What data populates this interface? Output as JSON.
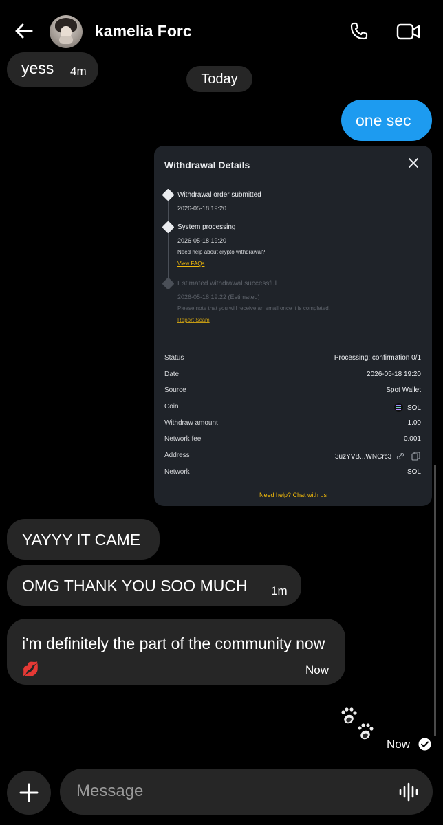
{
  "header": {
    "contact_name": "kamelia Forc",
    "icons": [
      "back-arrow-icon",
      "phone-icon",
      "video-icon"
    ]
  },
  "messages": {
    "yess": {
      "text": "yess",
      "time": "4m"
    },
    "day_separator": "Today",
    "one_sec": {
      "text": "one sec"
    },
    "yay": {
      "text": "YAYYY IT CAME"
    },
    "omg": {
      "text": "OMG THANK YOU SOO MUCH",
      "time": "1m"
    },
    "definitely": {
      "text": "i'm definitely the part of the community now",
      "emoji": "💋",
      "time": "Now"
    },
    "seen_status": "Now"
  },
  "withdrawal": {
    "title": "Withdrawal Details",
    "steps": [
      {
        "title": "Withdrawal order submitted",
        "date": "2026-05-18 19:20"
      },
      {
        "title": "System processing",
        "date": "2026-05-18 19:20",
        "note": "Need help about crypto withdrawal?",
        "link": "View FAQs"
      },
      {
        "title": "Estimated withdrawal successful",
        "date": "2026-05-18 19:22 (Estimated)",
        "note": "Please note that you will receive an email once it is completed.",
        "link": "Report Scam"
      }
    ],
    "rows": [
      {
        "label": "Status",
        "value": "Processing: confirmation 0/1"
      },
      {
        "label": "Date",
        "value": "2026-05-18 19:20"
      },
      {
        "label": "Source",
        "value": "Spot Wallet"
      },
      {
        "label": "Coin",
        "value": "SOL"
      },
      {
        "label": "Withdraw amount",
        "value": "1.00"
      },
      {
        "label": "Network fee",
        "value": "0.001"
      },
      {
        "label": "Address",
        "value": "3uzYVB...WNCrc3"
      },
      {
        "label": "Network",
        "value": "SOL"
      }
    ],
    "help_link": "Need help? Chat with us"
  },
  "composer": {
    "placeholder": "Message"
  },
  "colors": {
    "outgoing_bubble": "#1d9bf0",
    "incoming_bubble": "#262626",
    "accent_link": "#f0b90b"
  }
}
